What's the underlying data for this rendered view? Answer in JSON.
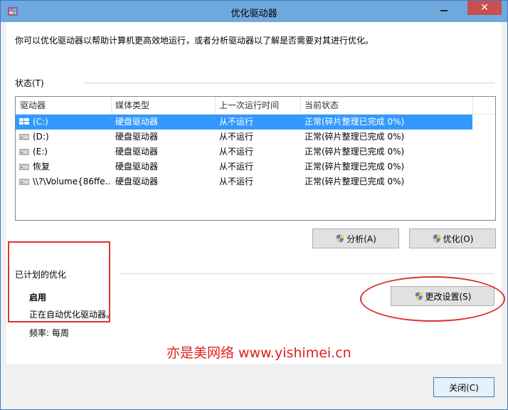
{
  "window": {
    "title": "优化驱动器",
    "close_glyph": "✕"
  },
  "intro_text": "你可以优化驱动器以帮助计算机更高效地运行，或者分析驱动器以了解是否需要对其进行优化。",
  "status_label": "状态(T)",
  "table": {
    "headers": [
      "驱动器",
      "媒体类型",
      "上一次运行时间",
      "当前状态"
    ],
    "rows": [
      {
        "drive": "(C:)",
        "media": "硬盘驱动器",
        "last_run": "从不运行",
        "status": "正常(碎片整理已完成 0%)",
        "icon": "windows-drive-icon"
      },
      {
        "drive": "(D:)",
        "media": "硬盘驱动器",
        "last_run": "从不运行",
        "status": "正常(碎片整理已完成 0%)",
        "icon": "hard-drive-icon"
      },
      {
        "drive": "(E:)",
        "media": "硬盘驱动器",
        "last_run": "从不运行",
        "status": "正常(碎片整理已完成 0%)",
        "icon": "hard-drive-icon"
      },
      {
        "drive": "恢复",
        "media": "硬盘驱动器",
        "last_run": "从不运行",
        "status": "正常(碎片整理已完成 0%)",
        "icon": "hard-drive-icon"
      },
      {
        "drive": "\\\\?\\Volume{86ffe...",
        "media": "硬盘驱动器",
        "last_run": "从不运行",
        "status": "正常(碎片整理已完成 0%)",
        "icon": "hard-drive-icon"
      }
    ]
  },
  "buttons": {
    "analyze": "分析(A)",
    "optimize": "优化(O)",
    "change_settings": "更改设置(S)",
    "close": "关闭(C)"
  },
  "schedule": {
    "label": "已计划的优化",
    "state": "启用",
    "description": "正在自动优化驱动器。",
    "frequency": "频率: 每周"
  },
  "watermark": "亦是美网络 www.yishimei.cn"
}
